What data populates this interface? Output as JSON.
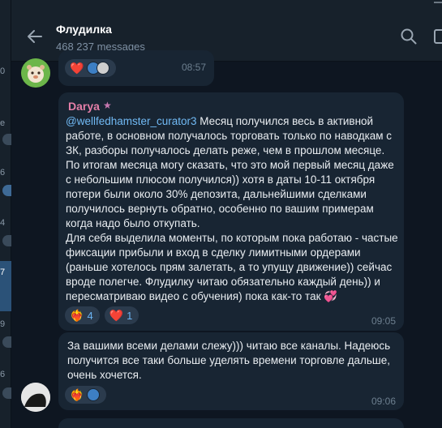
{
  "header": {
    "title": "Флудилка",
    "subtitle": "468 237 messages"
  },
  "left_strip": {
    "edge_labels": [
      "0",
      "e",
      "6",
      "4",
      "7",
      "9",
      "6"
    ]
  },
  "messages": [
    {
      "time": "08:57",
      "reactions": [
        {
          "icon": "heart-icon",
          "glyph": "❤️",
          "count": ""
        }
      ]
    },
    {
      "sender": "Darya",
      "sender_badge": "★",
      "mention": "@wellfedhamster_curator3",
      "text": " Месяц получился весь в активной работе, в основном получалось торговать только по наводкам с ЗК, разборы получалось делать реже, чем в прошлом месяце. По итогам месяца могу сказать, что это мой первый месяц даже с небольшим плюсом получился)) хотя в даты 10-11 октября потери были около 30% депозита, дальнейшими сделками получилось вернуть обратно, особенно по вашим примерам когда надо было откупать.\nДля себя выделила моменты, по которым пока работаю - частые фиксации прибыли и вход в сделку лимитными ордерами (раньше хотелось прям залетать, а то упущу движение)) сейчас вроде полегче.  Флудилку читаю обязательно каждый день)) и пересматриваю видео с обучения) пока как-то так 💞",
      "time": "09:05",
      "reactions": [
        {
          "icon": "heart-fire-icon",
          "glyph": "❤️‍🔥",
          "count": "4"
        },
        {
          "icon": "heart-icon",
          "glyph": "❤️",
          "count": "1"
        }
      ]
    },
    {
      "text": "За вашими всеми делами слежу))) читаю все каналы. Надеюсь получится все таки больше уделять времени торговле дальше, очень хочется.",
      "time": "09:06",
      "reactions": [
        {
          "icon": "heart-fire-icon",
          "glyph": "❤️‍🔥",
          "count": ""
        }
      ]
    }
  ],
  "colors": {
    "background": "#0e1621",
    "bubble": "#182533",
    "header": "#17212b",
    "accent": "#6ab3f3",
    "sender_name": "#e57fa8"
  }
}
